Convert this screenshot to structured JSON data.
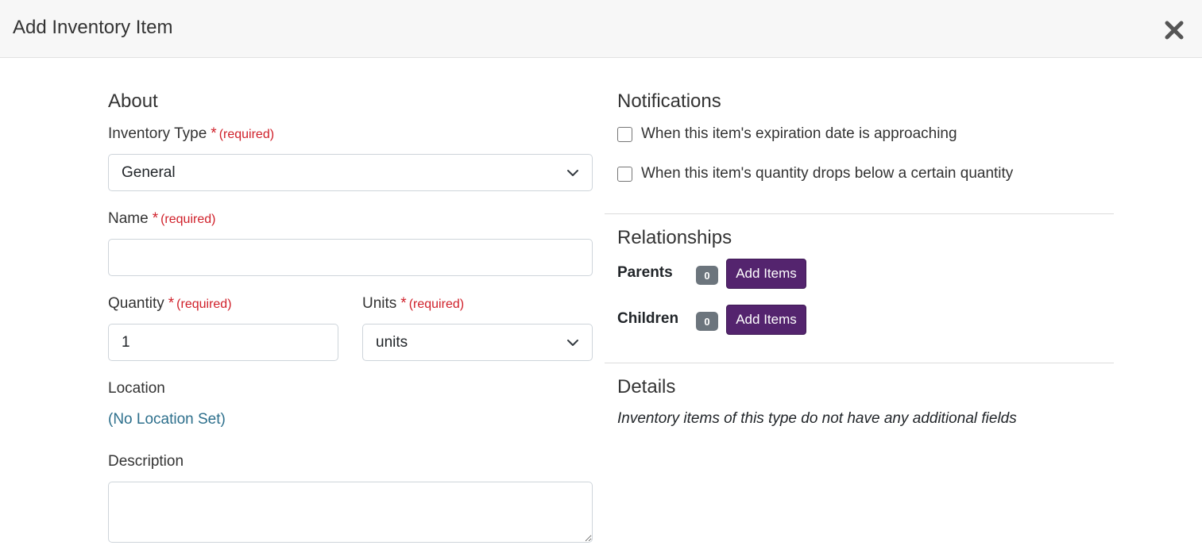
{
  "modal": {
    "title": "Add Inventory Item"
  },
  "about": {
    "title": "About",
    "inventory_type": {
      "label": "Inventory Type",
      "star": "*",
      "required": "(required)",
      "value": "General"
    },
    "name": {
      "label": "Name",
      "star": "*",
      "required": "(required)",
      "value": ""
    },
    "quantity": {
      "label": "Quantity",
      "star": "*",
      "required": "(required)",
      "value": "1"
    },
    "units": {
      "label": "Units",
      "star": "*",
      "required": "(required)",
      "value": "units"
    },
    "location": {
      "label": "Location",
      "link": "(No Location Set)"
    },
    "description": {
      "label": "Description",
      "value": ""
    }
  },
  "notifications": {
    "title": "Notifications",
    "options": [
      {
        "label": "When this item's expiration date is approaching",
        "checked": false
      },
      {
        "label": "When this item's quantity drops below a certain quantity",
        "checked": false
      }
    ]
  },
  "relationships": {
    "title": "Relationships",
    "parents": {
      "label": "Parents",
      "count": "0",
      "button": "Add Items"
    },
    "children": {
      "label": "Children",
      "count": "0",
      "button": "Add Items"
    }
  },
  "details": {
    "title": "Details",
    "note": "Inventory items of this type do not have any additional fields"
  },
  "colors": {
    "primary_button": "#54246e",
    "required": "#d0202a",
    "link": "#2d6f8c",
    "badge": "#6c757d"
  },
  "icons": {
    "close": "close-icon",
    "select": "chevron-down-icon"
  }
}
